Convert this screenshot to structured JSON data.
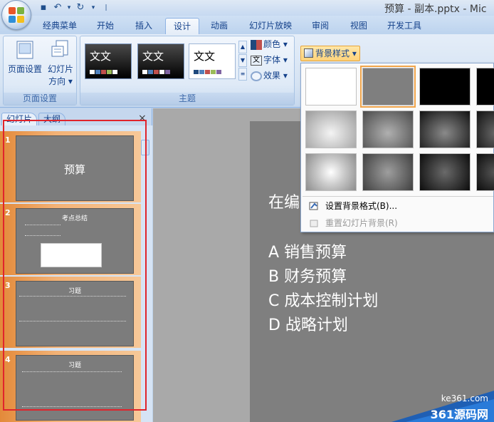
{
  "window": {
    "title": "预算 - 副本.pptx - Mic"
  },
  "tabs": [
    "经典菜单",
    "开始",
    "插入",
    "设计",
    "动画",
    "幻灯片放映",
    "审阅",
    "视图",
    "开发工具"
  ],
  "ribbon": {
    "page_setup": {
      "btn1": "页面设置",
      "btn2_line1": "幻灯片",
      "btn2_line2": "方向",
      "group_label": "页面设置"
    },
    "themes": {
      "group_label": "主题",
      "thumb_text": "文文"
    },
    "side": {
      "colors": "颜色",
      "fonts": "字体",
      "effects": "效果"
    }
  },
  "left_pane": {
    "tab_slides": "幻灯片",
    "tab_outline": "大纲",
    "close": "×"
  },
  "slides": [
    {
      "num": "1",
      "title": "预算"
    },
    {
      "num": "2",
      "title": "考点总结"
    },
    {
      "num": "3",
      "title": "习题"
    },
    {
      "num": "4",
      "title": "习题"
    }
  ],
  "main_slide": {
    "line0": "在编",
    "line1": "A  销售预算",
    "line2": "B  财务预算",
    "line3": "C  成本控制计划",
    "line4": "D  战略计划"
  },
  "bg_styles": {
    "button": "背景样式",
    "menu_format": "设置背景格式(B)...",
    "menu_reset": "重置幻灯片背景(R)"
  },
  "watermark": {
    "domain": "ke361.com",
    "brand": "361源码网"
  }
}
